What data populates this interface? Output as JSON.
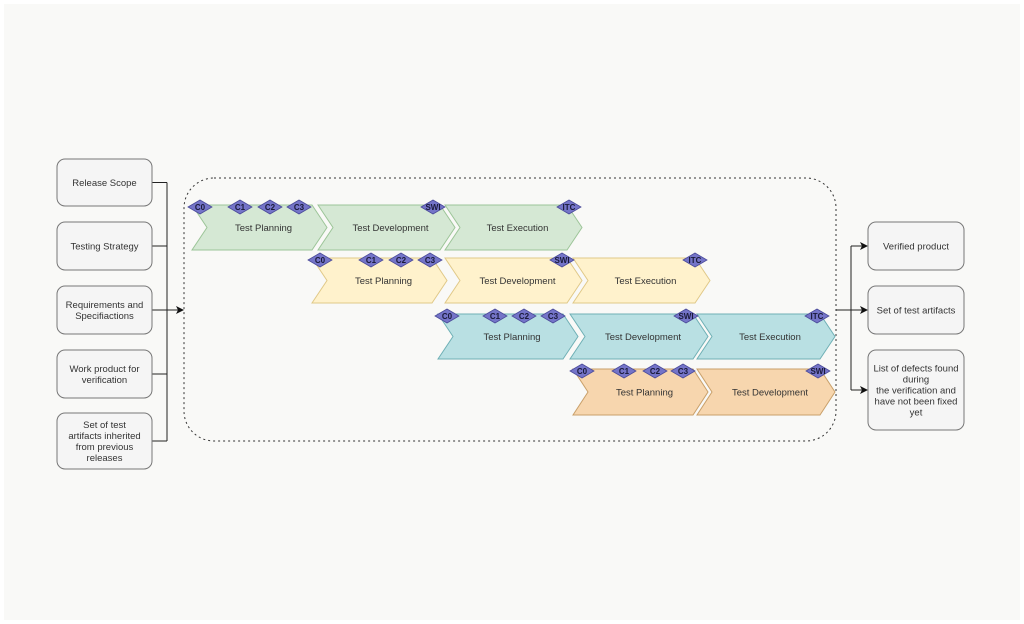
{
  "colors": {
    "background": "#f9f9f7",
    "box_fill": "#f5f5f5",
    "box_stroke": "#777777",
    "milestone_fill": "#7474c8",
    "milestone_stroke": "#4b4b99",
    "rows": [
      {
        "fill": "#d5e8d4",
        "stroke": "#9cc598"
      },
      {
        "fill": "#fff2cc",
        "stroke": "#e0c988"
      },
      {
        "fill": "#b9e0e3",
        "stroke": "#6fb0b5"
      },
      {
        "fill": "#f7d6ae",
        "stroke": "#c9a06a"
      }
    ]
  },
  "inputs": [
    {
      "lines": [
        "Release Scope"
      ]
    },
    {
      "lines": [
        "Testing Strategy"
      ]
    },
    {
      "lines": [
        "Requirements and",
        "Specifiactions"
      ]
    },
    {
      "lines": [
        "Work product for",
        "verification"
      ]
    },
    {
      "lines": [
        "Set of test",
        "artifacts inherited",
        "from previous",
        "releases"
      ]
    }
  ],
  "outputs": [
    {
      "lines": [
        "Verified product"
      ]
    },
    {
      "lines": [
        "Set of test artifacts"
      ]
    },
    {
      "lines": [
        "List of defects found",
        "during",
        "the verification and",
        "have not been fixed",
        "yet"
      ]
    }
  ],
  "rows": [
    {
      "phases": [
        "Test Planning",
        "Test Development",
        "Test Execution"
      ],
      "milestones": [
        "C0",
        "C1",
        "C2",
        "C3",
        "SWI",
        "ITC"
      ]
    },
    {
      "phases": [
        "Test Planning",
        "Test Development",
        "Test Execution"
      ],
      "milestones": [
        "C0",
        "C1",
        "C2",
        "C3",
        "SWI",
        "ITC"
      ]
    },
    {
      "phases": [
        "Test Planning",
        "Test Development",
        "Test Execution"
      ],
      "milestones": [
        "C0",
        "C1",
        "C2",
        "C3",
        "SWI",
        "ITC"
      ]
    },
    {
      "phases": [
        "Test Planning",
        "Test Development"
      ],
      "milestones": [
        "C0",
        "C1",
        "C2",
        "C3",
        "SWI"
      ]
    }
  ]
}
